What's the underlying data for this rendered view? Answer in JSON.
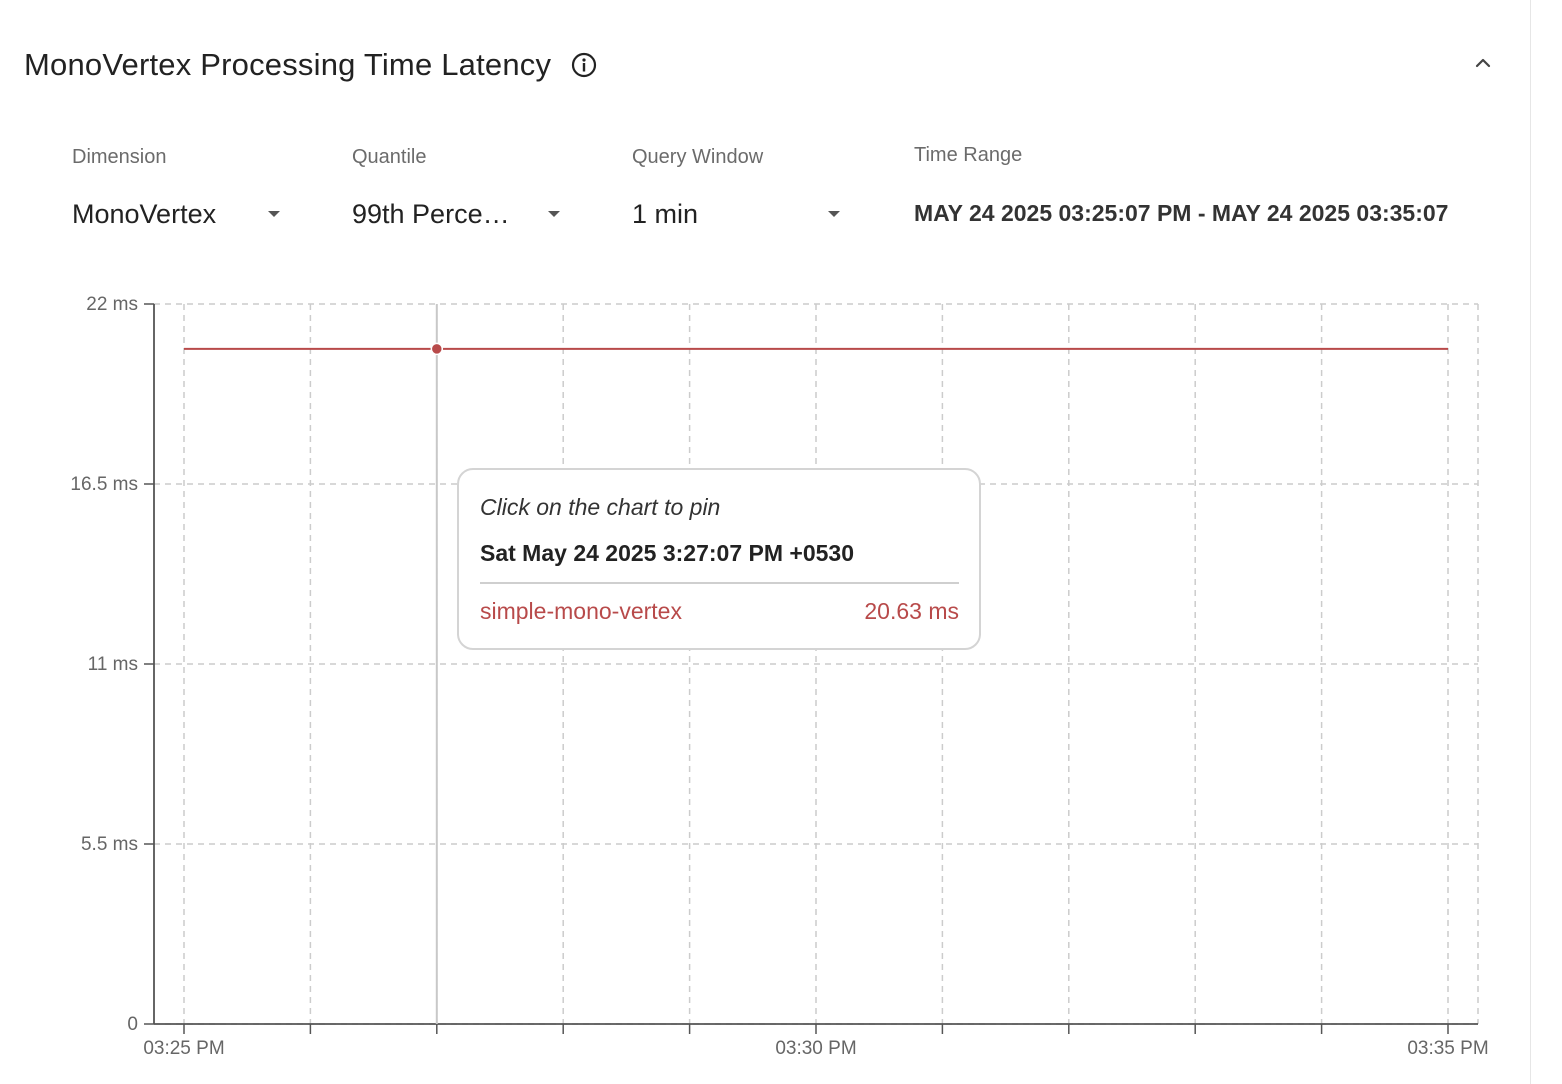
{
  "panel": {
    "title": "MonoVertex Processing Time Latency",
    "info_icon": "info-circle-icon",
    "collapse_icon": "chevron-up-icon"
  },
  "filters": {
    "dimension": {
      "label": "Dimension",
      "value": "MonoVertex"
    },
    "quantile": {
      "label": "Quantile",
      "value": "99th Perce…"
    },
    "query_window": {
      "label": "Query Window",
      "value": "1 min"
    },
    "time_range": {
      "label": "Time Range",
      "value": "MAY 24 2025 03:25:07 PM - MAY 24 2025 03:35:07"
    }
  },
  "tooltip": {
    "hint": "Click on the chart to pin",
    "date": "Sat May 24 2025 3:27:07 PM +0530",
    "series_name": "simple-mono-vertex",
    "series_value": "20.63 ms"
  },
  "colors": {
    "series": "#b84a4a",
    "grid": "#cccccc",
    "axis": "#555555"
  },
  "chart_data": {
    "type": "line",
    "title": "",
    "xlabel": "",
    "ylabel": "",
    "x_ticks": [
      "03:25 PM",
      "03:30 PM",
      "03:35 PM"
    ],
    "y_ticks": [
      "0",
      "5.5 ms",
      "11 ms",
      "16.5 ms",
      "22 ms"
    ],
    "ylim": [
      0,
      22
    ],
    "xlim": [
      "03:25 PM",
      "03:35 PM"
    ],
    "grid": true,
    "series": [
      {
        "name": "simple-mono-vertex",
        "x": [
          "03:25 PM",
          "03:35 PM"
        ],
        "values": [
          20.63,
          20.63
        ]
      }
    ],
    "hover": {
      "x": "03:27 PM",
      "value": 20.63
    }
  }
}
